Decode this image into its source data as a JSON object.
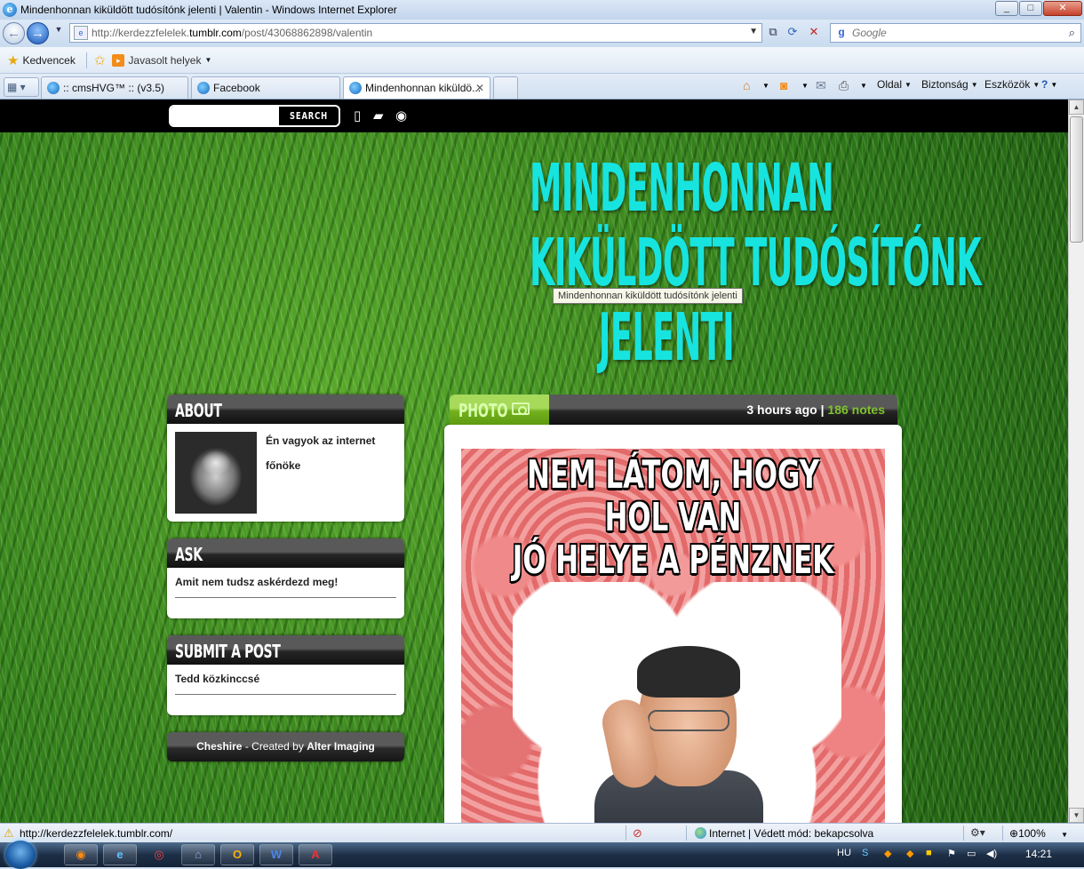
{
  "window": {
    "title": "Mindenhonnan kiküldött tudósítónk jelenti | Valentin - Windows Internet Explorer",
    "controls": {
      "minimize": "_",
      "maximize": "□",
      "close": "✕"
    }
  },
  "address_bar": {
    "url_prefix": "http://kerdezzfelelek.",
    "url_domain": "tumblr.com",
    "url_path": "/post/43068862898/valentin",
    "search_placeholder": "Google"
  },
  "favorites_bar": {
    "favorites_label": "Kedvencek",
    "suggested_label": "Javasolt helyek"
  },
  "tabs": [
    {
      "label": ":: cmsHVG™ :: (v3.5)",
      "active": false
    },
    {
      "label": "Facebook",
      "active": false
    },
    {
      "label": "Mindenhonnan kiküldö...",
      "active": true
    }
  ],
  "command_bar": {
    "page": "Oldal",
    "safety": "Biztonság",
    "tools": "Eszközök"
  },
  "tumblr": {
    "search_button": "SEARCH",
    "blog_title_lines": [
      "MINDENHONNAN",
      "KIKÜLDÖTT TUDÓSÍTÓNK",
      "JELENTI"
    ],
    "tooltip": "Mindenhonnan kiküldött tudósítónk jelenti",
    "about": {
      "heading": "ABOUT",
      "text": "Én vagyok az internet főnöke"
    },
    "ask": {
      "heading": "ASK",
      "text": "Amit nem tudsz askérdezd meg!"
    },
    "submit": {
      "heading": "SUBMIT A POST",
      "text": "Tedd közkinccsé"
    },
    "credit": {
      "theme": "Cheshire",
      "mid": " - Created by ",
      "author": "Alter Imaging"
    },
    "post": {
      "type_label": "PHOTO",
      "time": "3 hours ago",
      "separator": " | ",
      "notes": "186 notes",
      "meme_caption_lines": [
        "NEM LÁTOM, HOGY HOL VAN",
        "JÓ HELYE A PÉNZNEK"
      ]
    }
  },
  "status_bar": {
    "url": "http://kerdezzfelelek.tumblr.com/",
    "zone": "Internet | Védett mód: bekapcsolva",
    "zoom": "100%"
  },
  "taskbar": {
    "language": "HU",
    "clock": "14:21"
  }
}
